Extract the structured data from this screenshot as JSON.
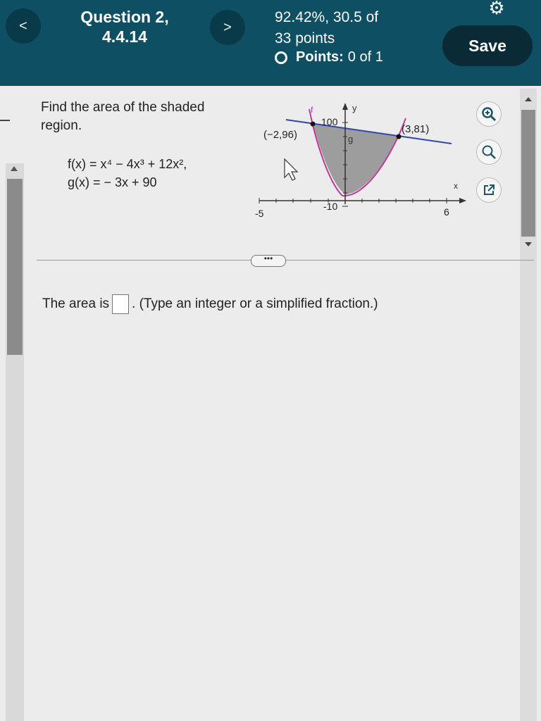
{
  "header": {
    "question_line1": "Question 2,",
    "question_line2": "4.4.14",
    "score_line1": "92.42%, 30.5 of",
    "score_line2": "33 points",
    "points_label": "Points:",
    "points_value": "0 of 1",
    "save_label": "Save",
    "prev_glyph": "<",
    "next_glyph": ">"
  },
  "question": {
    "prompt": "Find the area of the shaded region.",
    "f_def": "f(x) = x⁴ − 4x³ + 12x²,",
    "g_def": "g(x) = − 3x + 90",
    "more_label": "•••",
    "answer_prefix": "The area is",
    "answer_suffix": ". (Type an integer or a simplified fraction.)",
    "answer_value": ""
  },
  "graph": {
    "f_label": "f",
    "g_label": "g",
    "y_label": "y",
    "x_label": "x",
    "y_top_tick": "100",
    "y_bottom_tick": "-10",
    "x_left_tick": "-5",
    "x_right_tick": "6",
    "point_left": "(−2,96)",
    "point_right": "(3,81)"
  },
  "tools": {
    "zoom_in": "zoom-in-icon",
    "zoom_out": "zoom-out-icon",
    "popout": "external-link-icon"
  },
  "colors": {
    "header_bg": "#0f4f63",
    "save_bg": "#0a2b35",
    "curve_f": "#c0399c",
    "line_g": "#3346a6",
    "shade": "#8f8f8f"
  }
}
